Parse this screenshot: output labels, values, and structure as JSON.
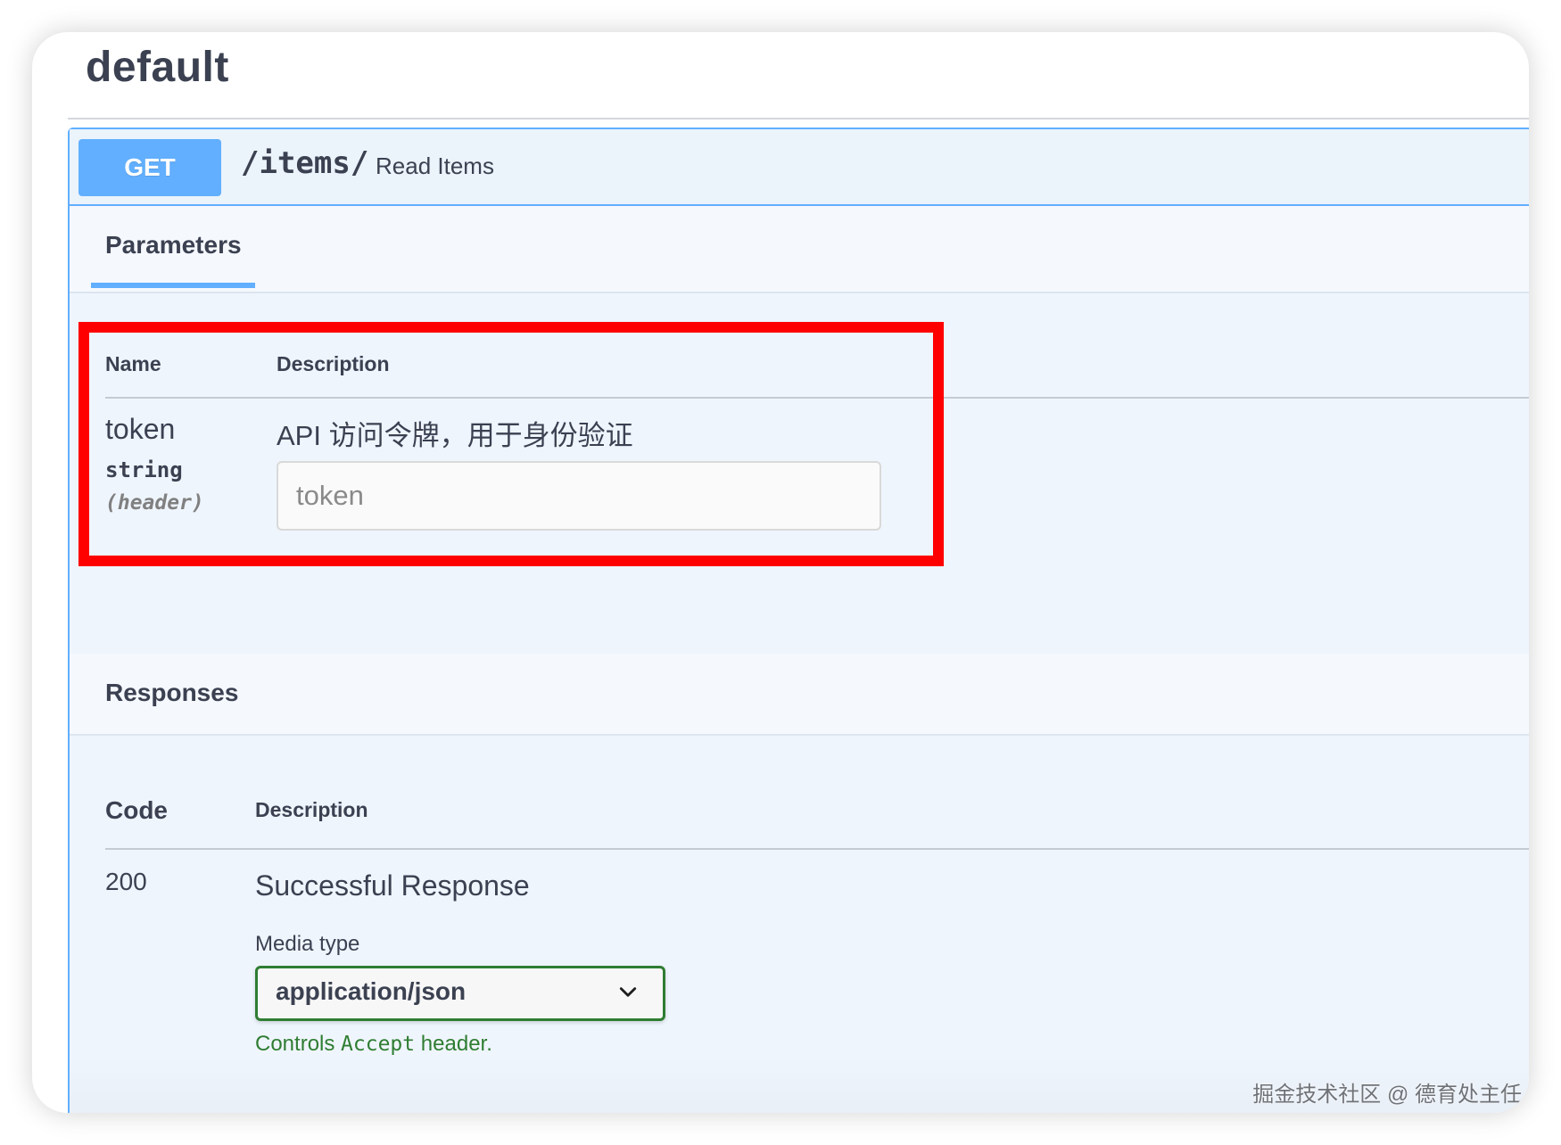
{
  "section": {
    "title": "default"
  },
  "operation": {
    "method": "GET",
    "path": "/items/",
    "summary": "Read Items",
    "method_color": "#61affe"
  },
  "parameters": {
    "tab_label": "Parameters",
    "headers": {
      "name": "Name",
      "description": "Description"
    },
    "items": [
      {
        "name": "token",
        "type": "string",
        "location": "(header)",
        "description": "API 访问令牌，用于身份验证",
        "placeholder": "token"
      }
    ],
    "highlight_color": "#ff0000"
  },
  "responses": {
    "title": "Responses",
    "headers": {
      "code": "Code",
      "description": "Description"
    },
    "items": [
      {
        "code": "200",
        "description": "Successful Response",
        "media_type_label": "Media type",
        "media_type_value": "application/json",
        "media_type_options": [
          "application/json"
        ],
        "controls_prefix": "Controls ",
        "controls_code": "Accept",
        "controls_suffix": " header."
      }
    ],
    "controls_color": "#2f7d32"
  },
  "watermark": "掘金技术社区 @ 德育处主任",
  "icons": {
    "select_chevron": "chevron-down-icon"
  }
}
